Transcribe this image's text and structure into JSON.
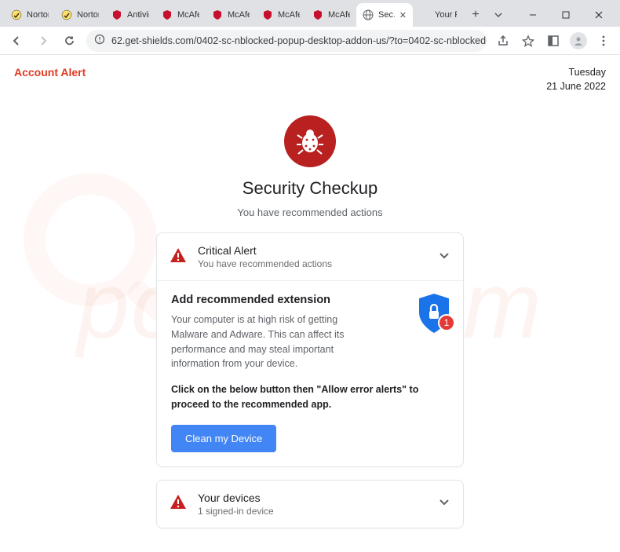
{
  "browser": {
    "tabs": [
      {
        "title": "Norton",
        "icon": "norton"
      },
      {
        "title": "Norton",
        "icon": "norton"
      },
      {
        "title": "Antivir…",
        "icon": "mcafee"
      },
      {
        "title": "McAfe…",
        "icon": "mcafee"
      },
      {
        "title": "McAfe…",
        "icon": "mcafee"
      },
      {
        "title": "McAfe…",
        "icon": "mcafee"
      },
      {
        "title": "McAfe…",
        "icon": "mcafee"
      },
      {
        "title": "Sec…",
        "icon": "globe",
        "active": true
      },
      {
        "title": "Your Pl…",
        "icon": "blank"
      }
    ],
    "url": "62.get-shields.com/0402-sc-nblocked-popup-desktop-addon-us/?to=0402-sc-nblocked-popup-desktop…"
  },
  "header": {
    "alert_label": "Account Alert",
    "day": "Tuesday",
    "date": "21 June 2022"
  },
  "main": {
    "title": "Security Checkup",
    "subtitle": "You have recommended actions"
  },
  "critical_card": {
    "title": "Critical Alert",
    "subtitle": "You have recommended actions",
    "body_title": "Add recommended extension",
    "body_text": "Your computer is at high risk of getting Malware and Adware. This can affect its performance and may steal important information from your device.",
    "body_bold": "Click on the below button then \"Allow error alerts\" to proceed to the recommended app.",
    "badge_count": "1",
    "button_label": "Clean my Device"
  },
  "devices_card": {
    "title": "Your devices",
    "subtitle": "1 signed-in device"
  }
}
